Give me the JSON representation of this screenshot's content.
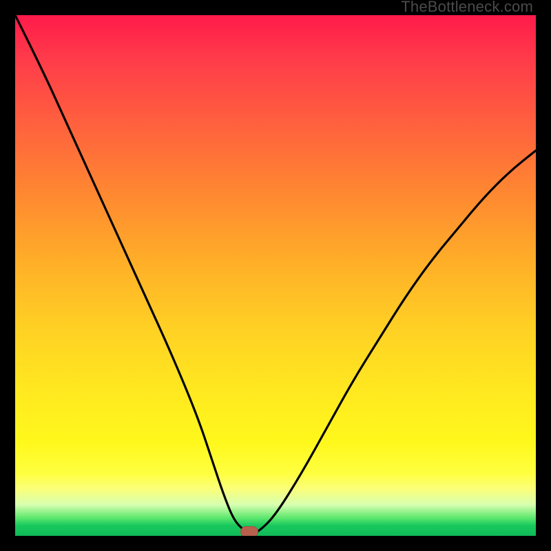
{
  "watermark": "TheBottleneck.com",
  "chart_data": {
    "type": "line",
    "title": "",
    "xlabel": "",
    "ylabel": "",
    "xlim": [
      0,
      100
    ],
    "ylim": [
      0,
      100
    ],
    "grid": false,
    "series": [
      {
        "name": "bottleneck-curve",
        "x": [
          0,
          5,
          10,
          15,
          20,
          25,
          30,
          35,
          38,
          40,
          42,
          44,
          45,
          47,
          50,
          55,
          60,
          65,
          70,
          75,
          80,
          85,
          90,
          95,
          100
        ],
        "y": [
          100,
          90,
          79,
          68,
          57,
          46,
          35,
          23,
          14,
          8,
          3,
          1,
          0,
          1,
          4,
          12,
          21,
          30,
          38,
          46,
          53,
          59,
          65,
          70,
          74
        ]
      }
    ],
    "marker": {
      "x": 45,
      "y": 0,
      "name": "optimal-point"
    },
    "background_gradient": {
      "top": "#ff1a4a",
      "mid": "#ffe820",
      "bottom": "#10b958"
    }
  }
}
